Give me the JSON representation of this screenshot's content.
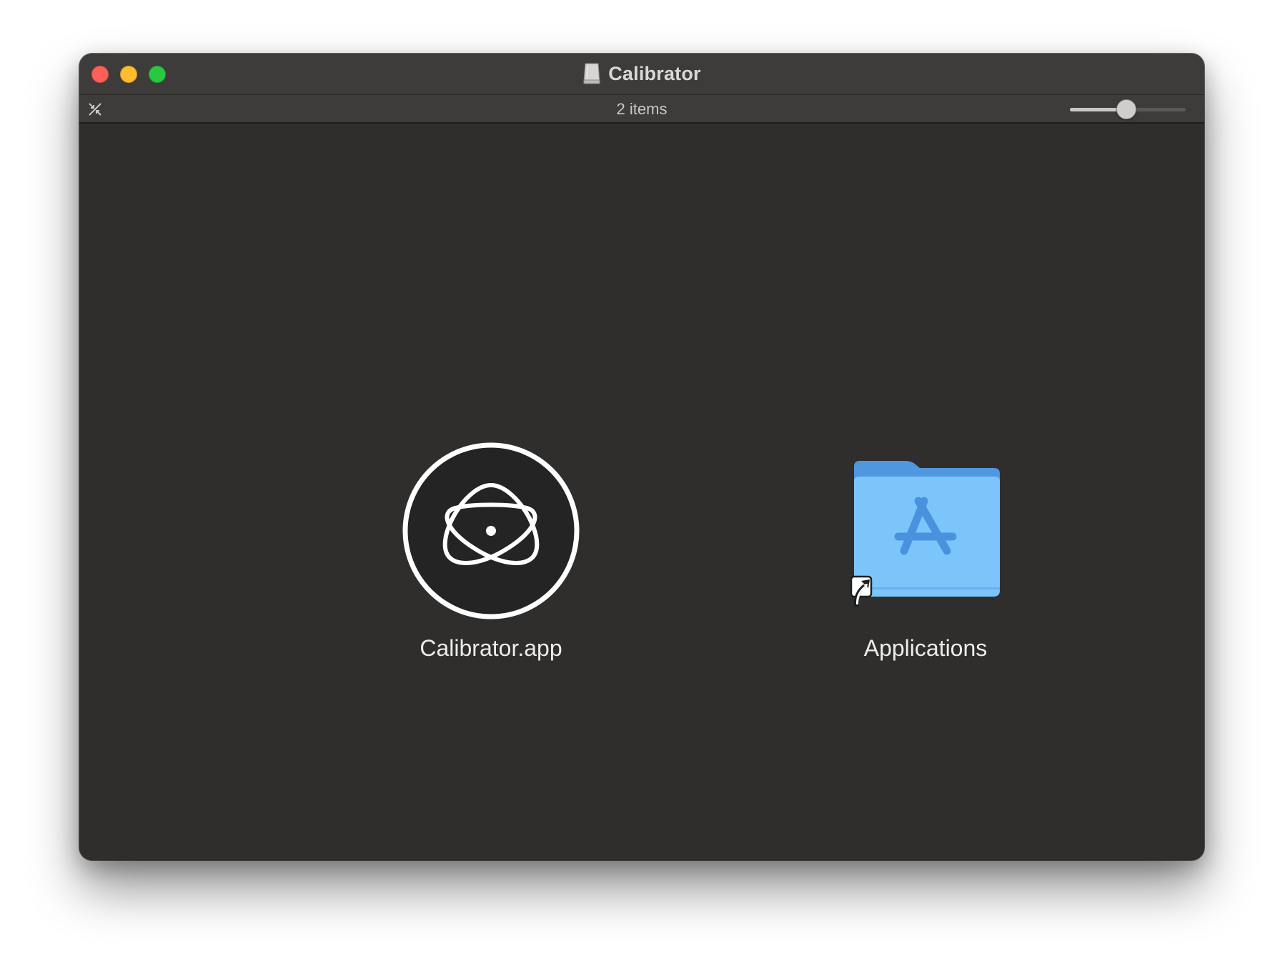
{
  "window": {
    "title": "Calibrator",
    "title_icon": "disk-image-icon",
    "controls": {
      "close_color": "#fe5f57",
      "minimize_color": "#febc2e",
      "maximize_color": "#28c840"
    }
  },
  "toolbar": {
    "collapse_icon": "collapse-arrows-icon",
    "status": "2 items",
    "icon_size_slider": {
      "value_fraction": 0.49
    }
  },
  "items": [
    {
      "label": "Calibrator.app",
      "icon": "calibrator-app-icon"
    },
    {
      "label": "Applications",
      "icon": "applications-folder-alias-icon",
      "folder_color": "#74c0fc"
    }
  ]
}
